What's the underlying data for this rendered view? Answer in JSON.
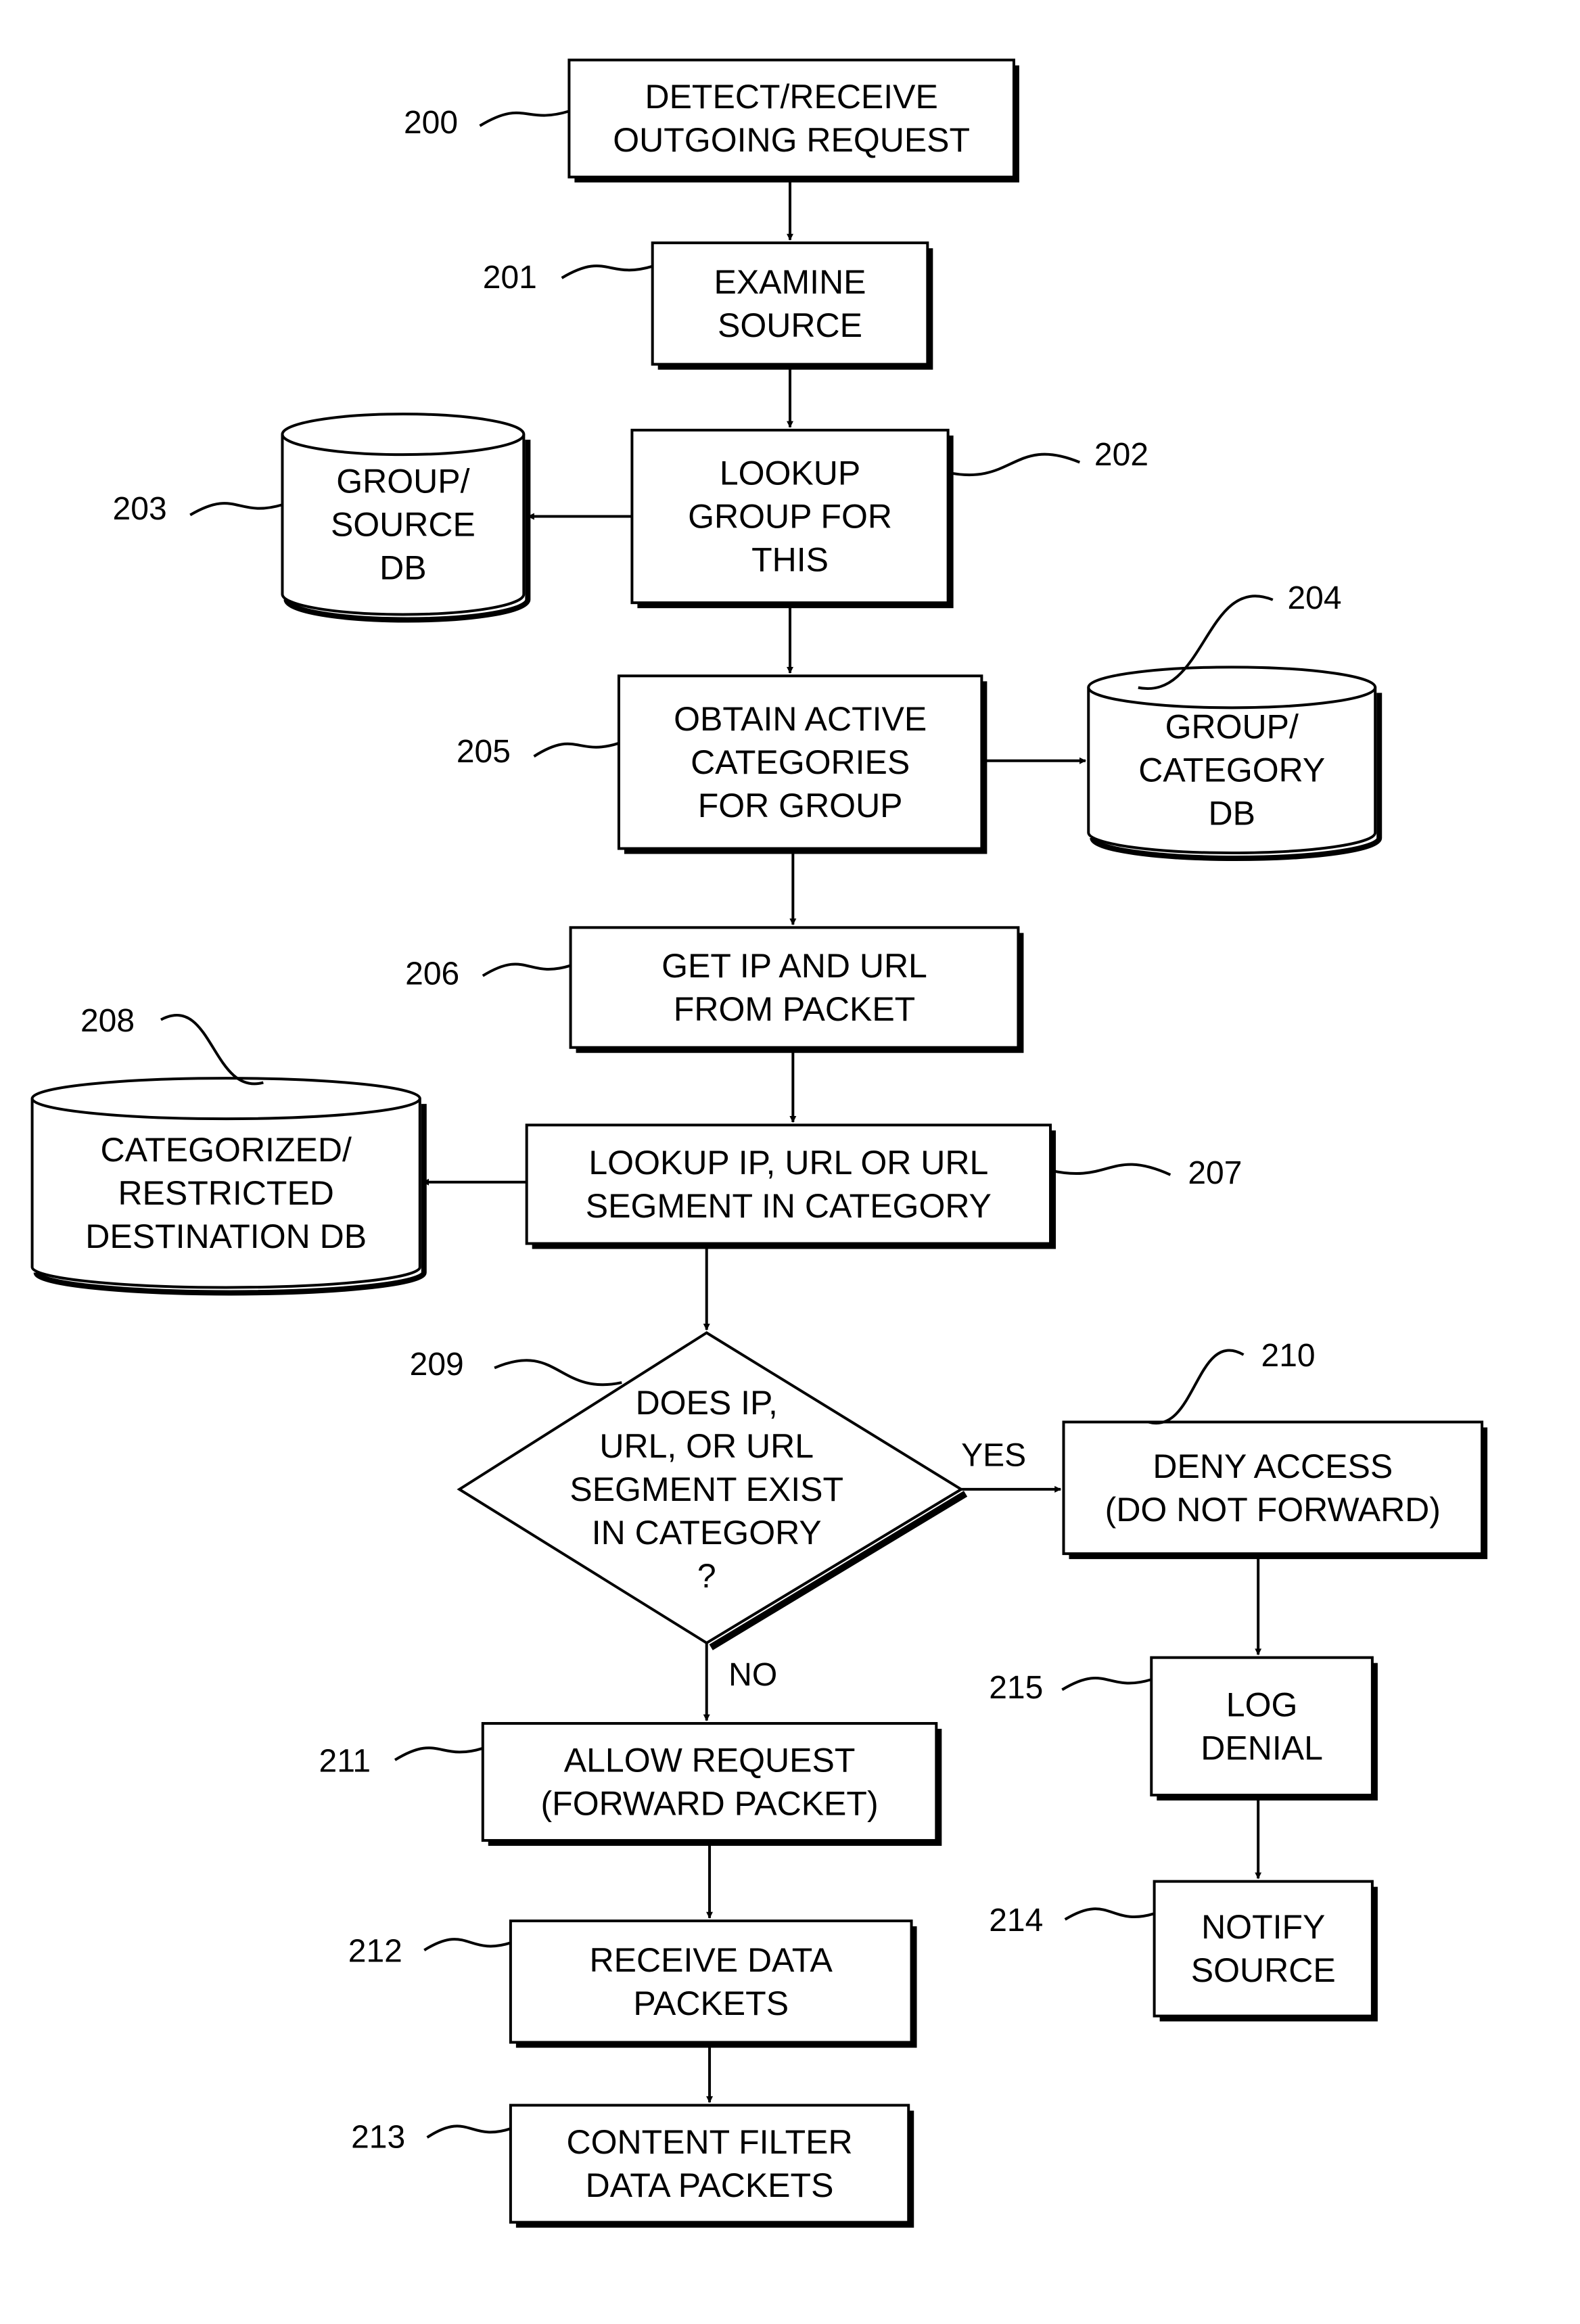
{
  "nodes": {
    "n200": {
      "ref": "200",
      "lines": [
        "DETECT/RECEIVE",
        "OUTGOING REQUEST"
      ]
    },
    "n201": {
      "ref": "201",
      "lines": [
        "EXAMINE",
        "SOURCE"
      ]
    },
    "n202": {
      "ref": "202",
      "lines": [
        "LOOKUP",
        "GROUP FOR",
        "THIS"
      ]
    },
    "n203": {
      "ref": "203",
      "lines": [
        "GROUP/",
        "SOURCE",
        "DB"
      ]
    },
    "n204": {
      "ref": "204",
      "lines": [
        "GROUP/",
        "CATEGORY",
        "DB"
      ]
    },
    "n205": {
      "ref": "205",
      "lines": [
        "OBTAIN ACTIVE",
        "CATEGORIES",
        "FOR GROUP"
      ]
    },
    "n206": {
      "ref": "206",
      "lines": [
        "GET IP AND URL",
        "FROM PACKET"
      ]
    },
    "n207": {
      "ref": "207",
      "lines": [
        "LOOKUP IP, URL OR URL",
        "SEGMENT IN CATEGORY"
      ]
    },
    "n208": {
      "ref": "208",
      "lines": [
        "CATEGORIZED/",
        "RESTRICTED",
        "DESTINATION DB"
      ]
    },
    "n209": {
      "ref": "209",
      "lines": [
        "DOES IP,",
        "URL, OR URL",
        "SEGMENT EXIST",
        "IN CATEGORY",
        "?"
      ]
    },
    "n210": {
      "ref": "210",
      "lines": [
        "DENY ACCESS",
        "(DO NOT FORWARD)"
      ]
    },
    "n211": {
      "ref": "211",
      "lines": [
        "ALLOW REQUEST",
        "(FORWARD PACKET)"
      ]
    },
    "n212": {
      "ref": "212",
      "lines": [
        "RECEIVE DATA",
        "PACKETS"
      ]
    },
    "n213": {
      "ref": "213",
      "lines": [
        "CONTENT FILTER",
        "DATA PACKETS"
      ]
    },
    "n214": {
      "ref": "214",
      "lines": [
        "NOTIFY",
        "SOURCE"
      ]
    },
    "n215": {
      "ref": "215",
      "lines": [
        "LOG",
        "DENIAL"
      ]
    }
  },
  "edge_labels": {
    "yes": "YES",
    "no": "NO"
  }
}
